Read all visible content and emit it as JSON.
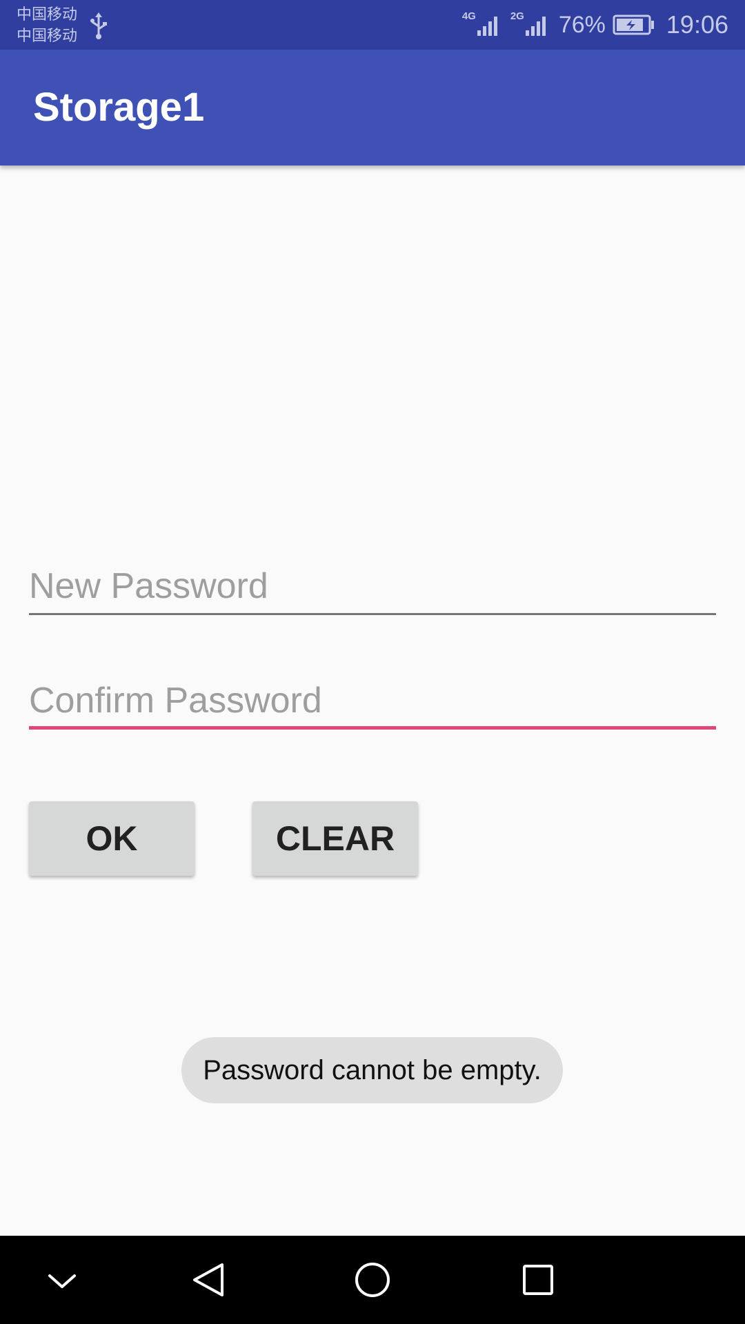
{
  "status_bar": {
    "carriers": [
      "中国移动",
      "中国移动"
    ],
    "network_1": "4G",
    "network_2": "2G",
    "battery_percent": "76%",
    "time": "19:06"
  },
  "app_bar": {
    "title": "Storage1"
  },
  "form": {
    "new_password_hint": "New Password",
    "confirm_password_hint": "Confirm Password",
    "ok_label": "OK",
    "clear_label": "CLEAR"
  },
  "toast": {
    "message": "Password cannot be empty."
  },
  "colors": {
    "status_bar": "#303f9f",
    "app_bar": "#3f51b5",
    "accent": "#e0457b"
  },
  "icons": {
    "usb": "usb-icon",
    "signal": "signal-bars-icon",
    "battery": "battery-charging-icon",
    "nav_down": "chevron-down-icon",
    "nav_back": "back-triangle-icon",
    "nav_home": "home-circle-icon",
    "nav_recent": "recent-square-icon"
  }
}
